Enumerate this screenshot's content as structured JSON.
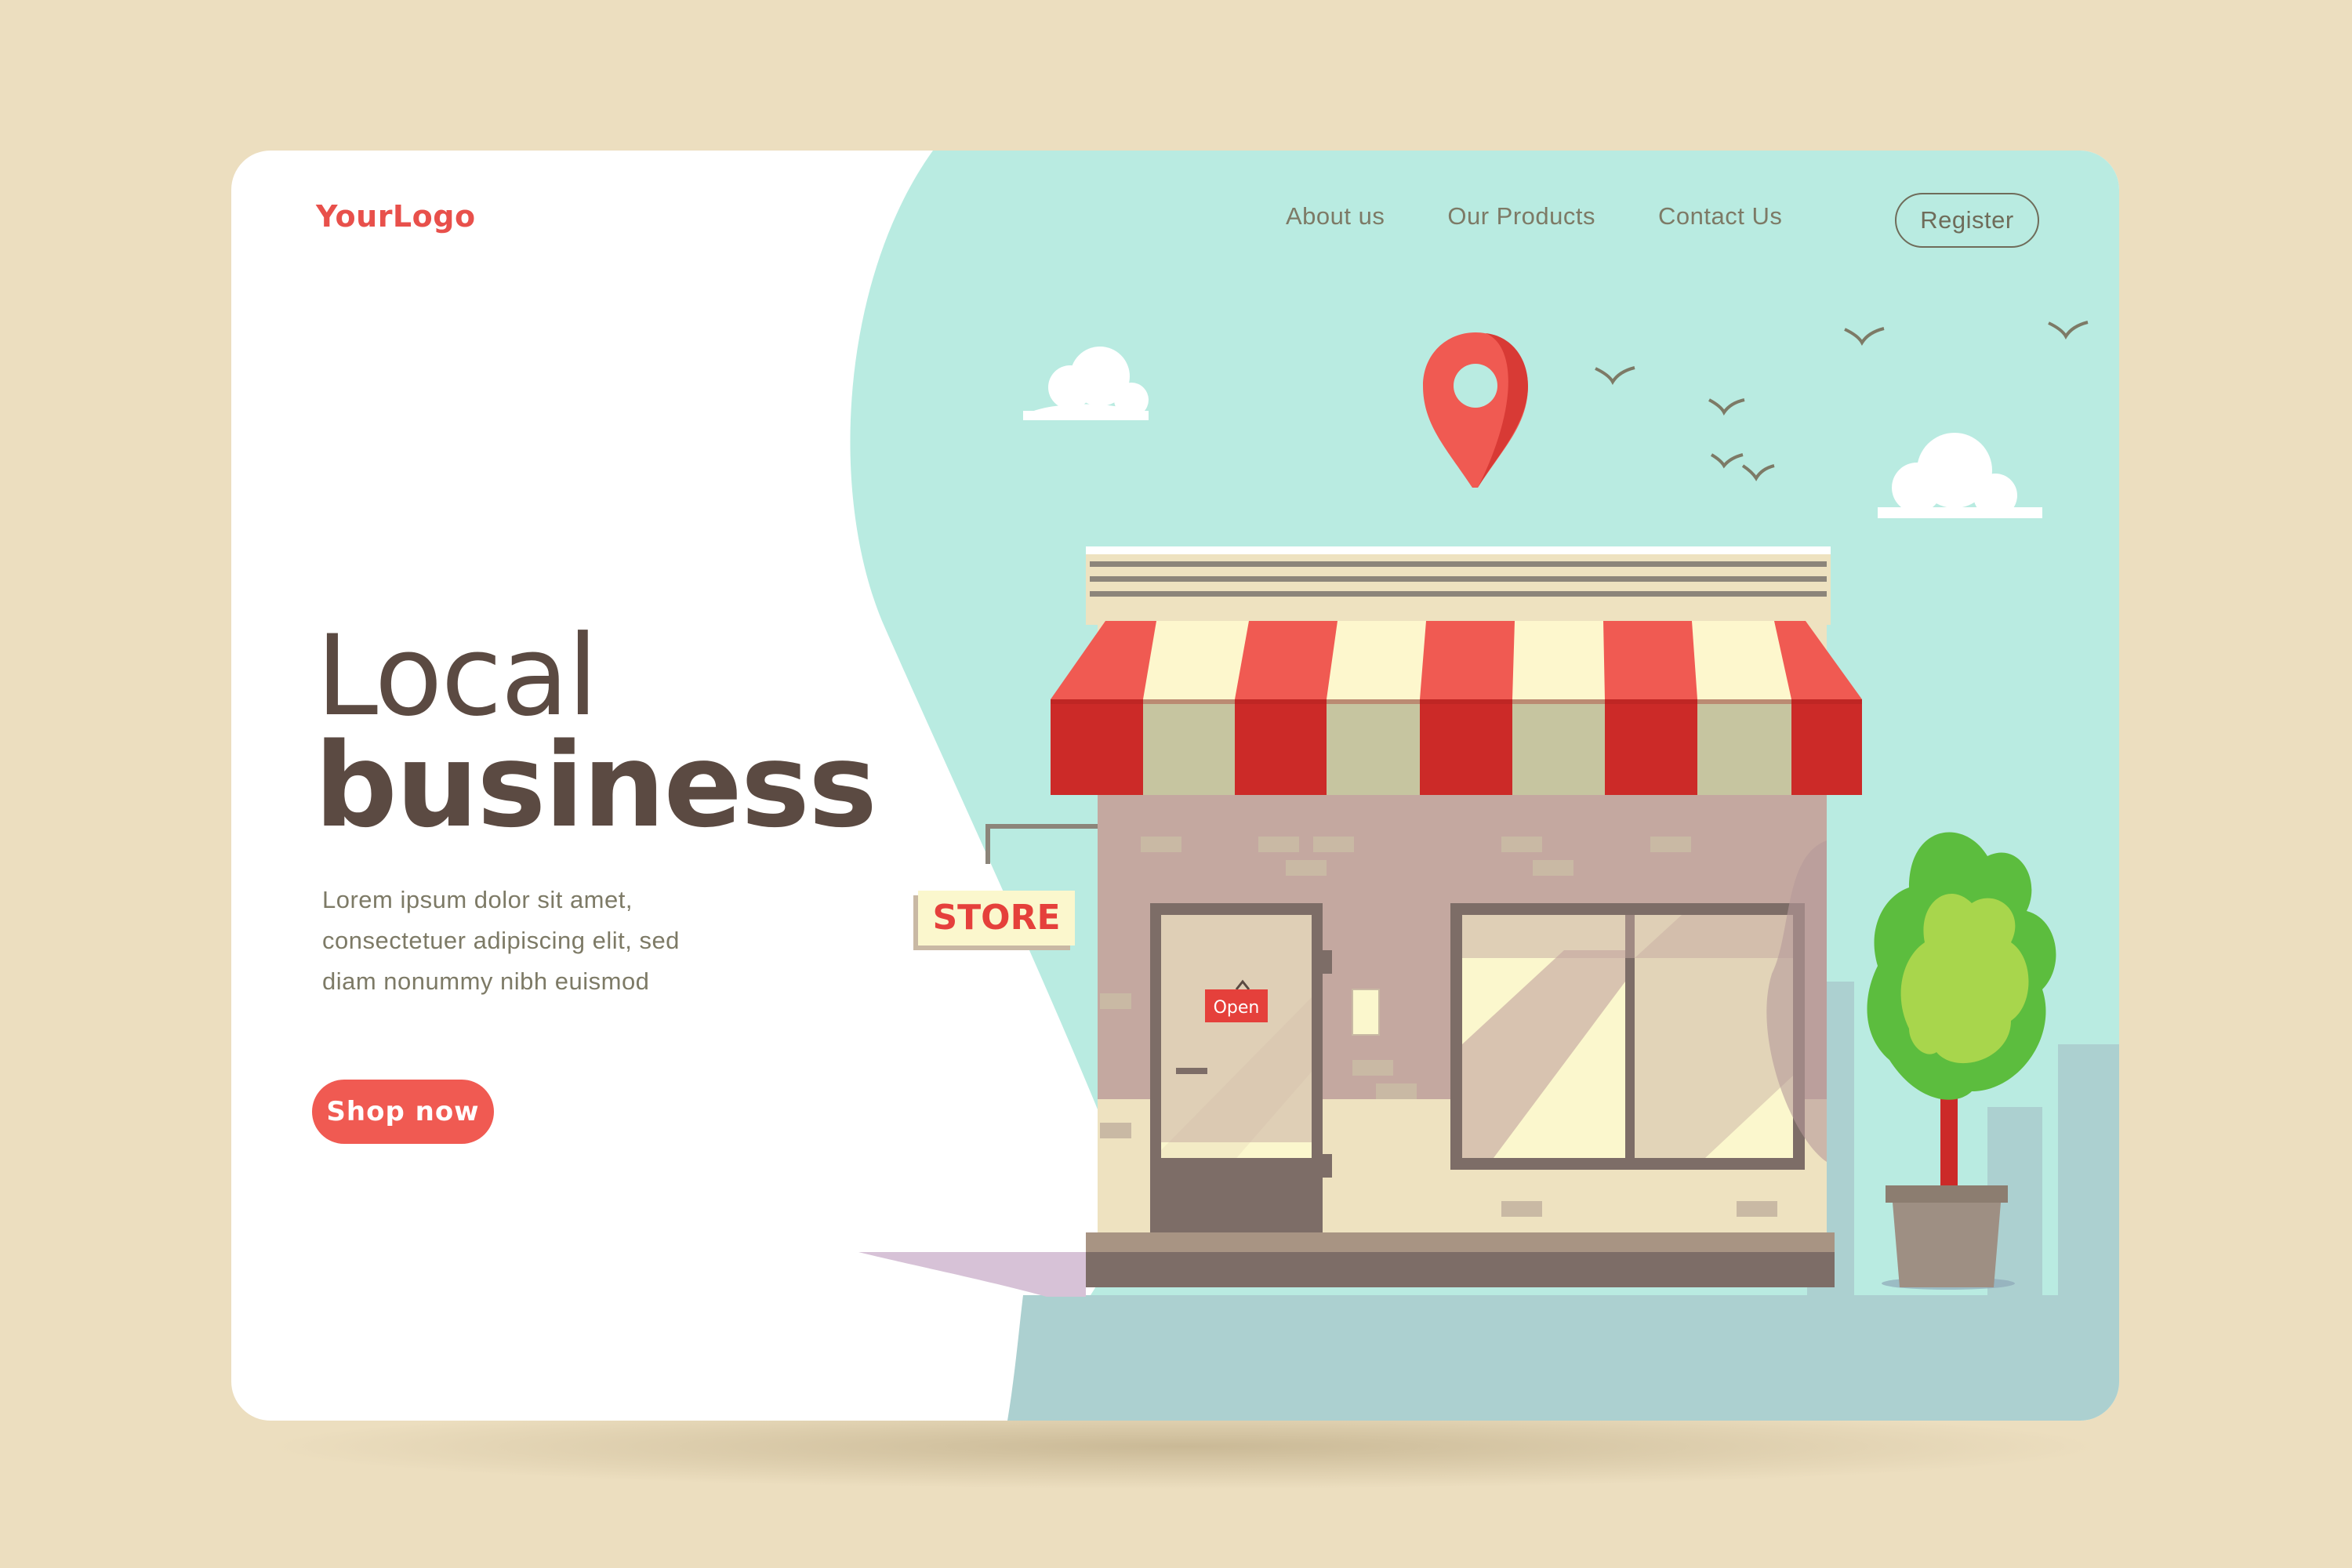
{
  "header": {
    "logo": "YourLogo",
    "nav": [
      "About us",
      "Our Products",
      "Contact Us"
    ],
    "register": "Register"
  },
  "hero": {
    "title_light": "Local",
    "title_bold": "business",
    "description_lines": [
      "Lorem ipsum dolor sit amet,",
      "consectetuer adipiscing elit, sed",
      "diam nonummy nibh euismod"
    ],
    "cta": "Shop now"
  },
  "illustration": {
    "store_sign": "STORE",
    "door_sign": "Open"
  },
  "colors": {
    "background": "#ecdebf",
    "accent": "#f05a52",
    "sky": "#b9ebe1",
    "text_dark": "#5b4a42",
    "text_muted": "#7d7a66"
  }
}
